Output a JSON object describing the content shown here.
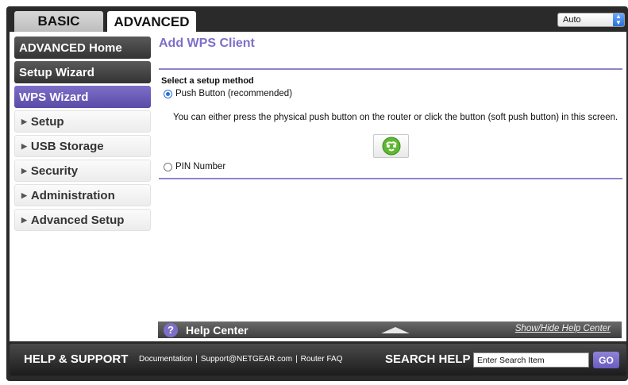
{
  "tabs": {
    "basic": "BASIC",
    "advanced": "ADVANCED"
  },
  "language_select": {
    "value": "Auto"
  },
  "sidebar": {
    "items": [
      {
        "label": "ADVANCED Home"
      },
      {
        "label": "Setup Wizard"
      },
      {
        "label": "WPS Wizard"
      },
      {
        "label": "Setup"
      },
      {
        "label": "USB Storage"
      },
      {
        "label": "Security"
      },
      {
        "label": "Administration"
      },
      {
        "label": "Advanced Setup"
      }
    ]
  },
  "main": {
    "title": "Add WPS Client",
    "setup_method_label": "Select a setup method",
    "option_push": "Push Button (recommended)",
    "push_description": "You can either press the physical push button on the router or click the button (soft push button) in this screen.",
    "option_pin": "PIN Number"
  },
  "help_center": {
    "title": "Help Center",
    "toggle": "Show/Hide Help Center"
  },
  "footer": {
    "help_support": "HELP & SUPPORT",
    "links": [
      "Documentation",
      "Support@NETGEAR.com",
      "Router FAQ"
    ],
    "link_separator": "|",
    "search_label": "SEARCH HELP",
    "search_value": "Enter Search Item",
    "go_label": "GO"
  },
  "colors": {
    "accent": "#7d6fc8",
    "dark": "#2a2a2a"
  }
}
